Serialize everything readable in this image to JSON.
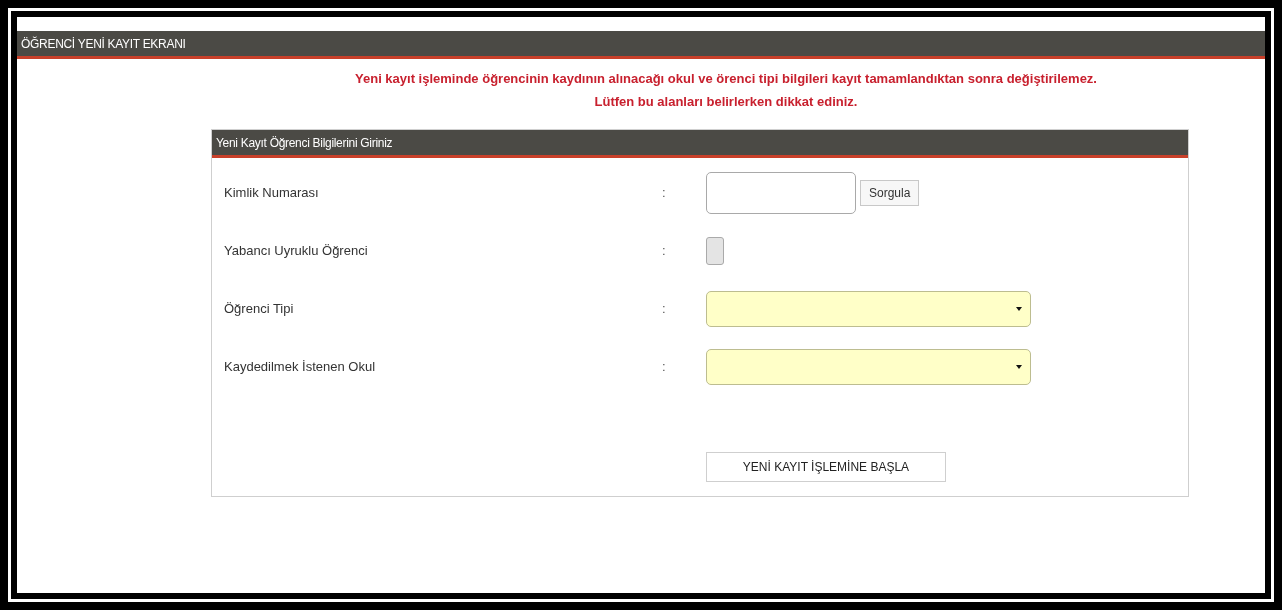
{
  "window": {
    "title": "ÖĞRENCİ  YENİ KAYIT  EKRANI"
  },
  "warning": [
    "Yeni kayıt işleminde öğrencinin kaydının alınacağı okul ve örenci tipi bilgileri kayıt tamamlandıktan sonra değiştirilemez.",
    "Lütfen bu alanları belirlerken dikkat ediniz."
  ],
  "form": {
    "title": "Yeni Kayıt Öğrenci Bilgilerini Giriniz",
    "fields": [
      {
        "kind": "text",
        "label": "Kimlik Numarası",
        "separator": ":",
        "button": "Sorgula"
      },
      {
        "kind": "checkbox",
        "label": "Yabancı Uyruklu Öğrenci",
        "separator": ":",
        "checked": false
      },
      {
        "kind": "select",
        "label": "Öğrenci Tipi",
        "separator": ":"
      },
      {
        "kind": "select",
        "label": "Kaydedilmek İstenen Okul",
        "separator": ":"
      }
    ],
    "submit": "YENİ KAYIT İŞLEMİNE BAŞLA"
  }
}
